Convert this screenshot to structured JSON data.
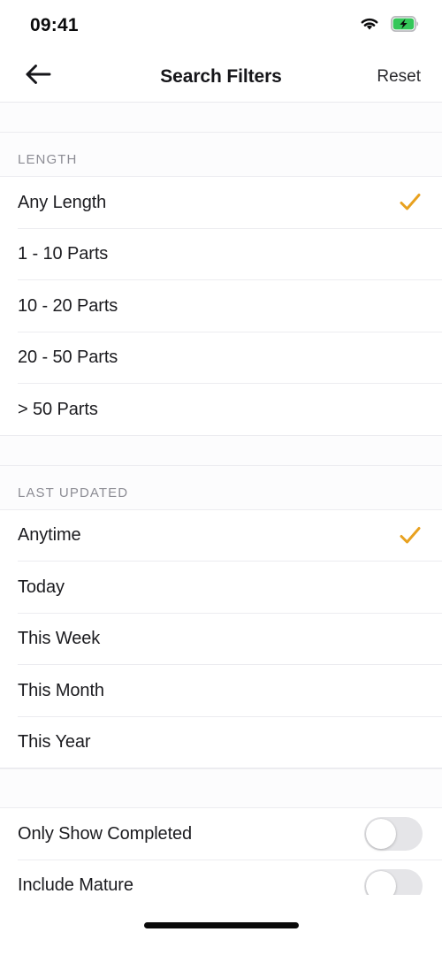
{
  "status_bar": {
    "time": "09:41",
    "wifi_icon": "wifi-icon",
    "battery_icon": "battery-charging-icon",
    "battery_color": "#34C759"
  },
  "nav_bar": {
    "back_icon": "arrow-left-icon",
    "title": "Search Filters",
    "reset_label": "Reset"
  },
  "theme": {
    "accent": "#E8A11F",
    "text": "#1B1B1F",
    "muted_text": "#8C8C94",
    "divider": "#ECECF0",
    "background": "#FFFFFF",
    "group_background": "#FCFCFD",
    "switch_off_track": "#E5E5E8"
  },
  "sections": [
    {
      "header": "LENGTH",
      "options": [
        {
          "label": "Any Length",
          "selected": true
        },
        {
          "label": "1 - 10 Parts",
          "selected": false
        },
        {
          "label": "10 - 20 Parts",
          "selected": false
        },
        {
          "label": "20 - 50 Parts",
          "selected": false
        },
        {
          "label": "> 50 Parts",
          "selected": false
        }
      ]
    },
    {
      "header": "LAST UPDATED",
      "options": [
        {
          "label": "Anytime",
          "selected": true
        },
        {
          "label": "Today",
          "selected": false
        },
        {
          "label": "This Week",
          "selected": false
        },
        {
          "label": "This Month",
          "selected": false
        },
        {
          "label": "This Year",
          "selected": false
        }
      ]
    }
  ],
  "toggles": [
    {
      "label": "Only Show Completed",
      "on": false
    },
    {
      "label": "Include Mature",
      "on": false
    }
  ],
  "home_indicator": "home-indicator"
}
